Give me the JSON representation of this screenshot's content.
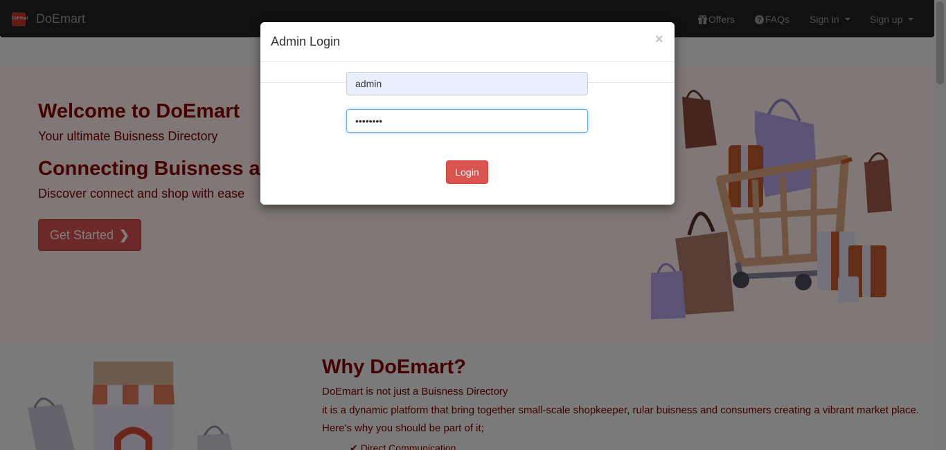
{
  "navbar": {
    "logo_text": "DoEmart",
    "brand": "DoEmart",
    "items": [
      {
        "label": "Offers",
        "icon": "gift-icon"
      },
      {
        "label": "FAQs",
        "icon": "question-circle-icon"
      },
      {
        "label": "Sign in",
        "icon": "caret-down-icon"
      },
      {
        "label": "Sign up",
        "icon": "caret-down-icon"
      }
    ]
  },
  "hero": {
    "welcome": "Welcome to DoEmart",
    "tagline": "Your ultimate Buisness Directory",
    "connecting": "Connecting Buisness a",
    "subtitle": "Discover connect and shop with ease",
    "cta": "Get Started"
  },
  "why": {
    "title": "Why DoEmart?",
    "lines": [
      "DoEmart is not just a Buisness Directory",
      "it is a dynamic platform that bring together small-scale shopkeeper, rular buisness and consumers creating a vibrant market place.",
      "Here's why you should be part of it;"
    ],
    "points": [
      "Direct Communication"
    ]
  },
  "modal": {
    "title": "Admin Login",
    "close": "×",
    "username_value": "admin",
    "password_value": "••••••••",
    "login_label": "Login"
  },
  "colors": {
    "brand_red": "#d9534f",
    "heading_red": "#8b0000",
    "navbar_bg": "#222222"
  }
}
